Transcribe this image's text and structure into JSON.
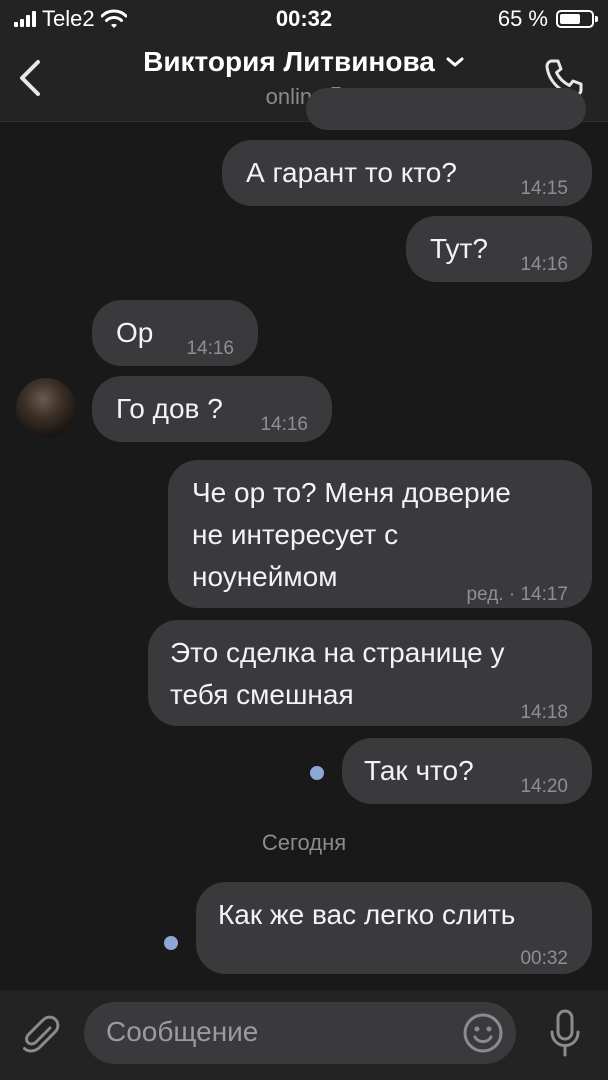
{
  "status_bar": {
    "carrier": "Tele2",
    "time": "00:32",
    "battery": "65 %",
    "battery_level": 0.65
  },
  "header": {
    "name": "Виктория Литвинова",
    "status": "online"
  },
  "messages": [
    {
      "text": "А гарант то кто?",
      "time": "14:15",
      "dir": "out"
    },
    {
      "text": "Тут?",
      "time": "14:16",
      "dir": "out"
    },
    {
      "text": "Ор",
      "time": "14:16",
      "dir": "in"
    },
    {
      "text": "Го дов ?",
      "time": "14:16",
      "dir": "in"
    },
    {
      "text": "Че ор то? Меня доверие\nне интересует с\nноунеймом",
      "time": "14:17",
      "edited": "ред. ·",
      "dir": "out"
    },
    {
      "text": "Это сделка на странице у\nтебя смешная",
      "time": "14:18",
      "dir": "out"
    },
    {
      "text": "Так что?",
      "time": "14:20",
      "dir": "out",
      "unread": true
    },
    {
      "text": "Как же вас легко слить",
      "time": "00:32",
      "dir": "out",
      "unread": true
    }
  ],
  "date_separator": "Сегодня",
  "composer": {
    "placeholder": "Сообщение"
  },
  "colors": {
    "background": "#19191a",
    "bubble": "#3a3a3c",
    "unread_dot": "#8ea7d6"
  },
  "icons": [
    "signal-icon",
    "wifi-icon",
    "battery-icon",
    "back-chevron-icon",
    "chevron-down-icon",
    "mobile-icon",
    "phone-icon",
    "paperclip-icon",
    "emoji-icon",
    "microphone-icon"
  ]
}
